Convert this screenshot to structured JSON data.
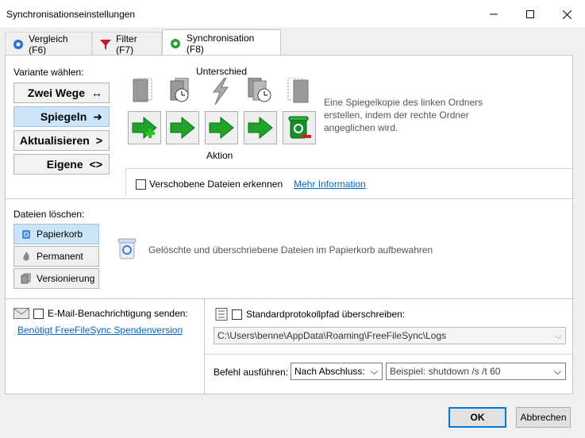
{
  "window": {
    "title": "Synchronisationseinstellungen"
  },
  "tabs": [
    {
      "label": "Vergleich (F6)",
      "icon": "gear-blue-icon"
    },
    {
      "label": "Filter (F7)",
      "icon": "funnel-icon"
    },
    {
      "label": "Synchronisation (F8)",
      "icon": "gear-green-icon"
    }
  ],
  "variant": {
    "label": "Variante wählen:",
    "options": [
      {
        "label": "Zwei Wege",
        "symbol": "↔"
      },
      {
        "label": "Spiegeln",
        "symbol": "➜"
      },
      {
        "label": "Aktualisieren",
        "symbol": ">"
      },
      {
        "label": "Eigene",
        "symbol": "<>"
      }
    ],
    "selected": "Spiegeln"
  },
  "difference": {
    "label": "Unterschied"
  },
  "action": {
    "label": "Aktion"
  },
  "description": "Eine Spiegelkopie des linken Ordners erstellen, indem der rechte Ordner angeglichen wird.",
  "moved_files": {
    "label": "Verschobene Dateien erkennen",
    "link": "Mehr Information"
  },
  "delete_files": {
    "label": "Dateien löschen:",
    "options": [
      "Papierkorb",
      "Permanent",
      "Versionierung"
    ],
    "selected": "Papierkorb",
    "description": "Gelöschte und überschriebene Dateien im Papierkorb aufbewahren"
  },
  "email": {
    "label": "E-Mail-Benachrichtigung senden:",
    "link": "Benötigt FreeFileSync Spendenversion"
  },
  "log": {
    "label": "Standardprotokollpfad überschreiben:",
    "path": "C:\\Users\\benne\\AppData\\Roaming\\FreeFileSync\\Logs"
  },
  "command": {
    "label": "Befehl ausführen:",
    "when": "Nach Abschluss:",
    "placeholder": "Beispiel: shutdown /s /t 60"
  },
  "buttons": {
    "ok": "OK",
    "cancel": "Abbrechen"
  }
}
